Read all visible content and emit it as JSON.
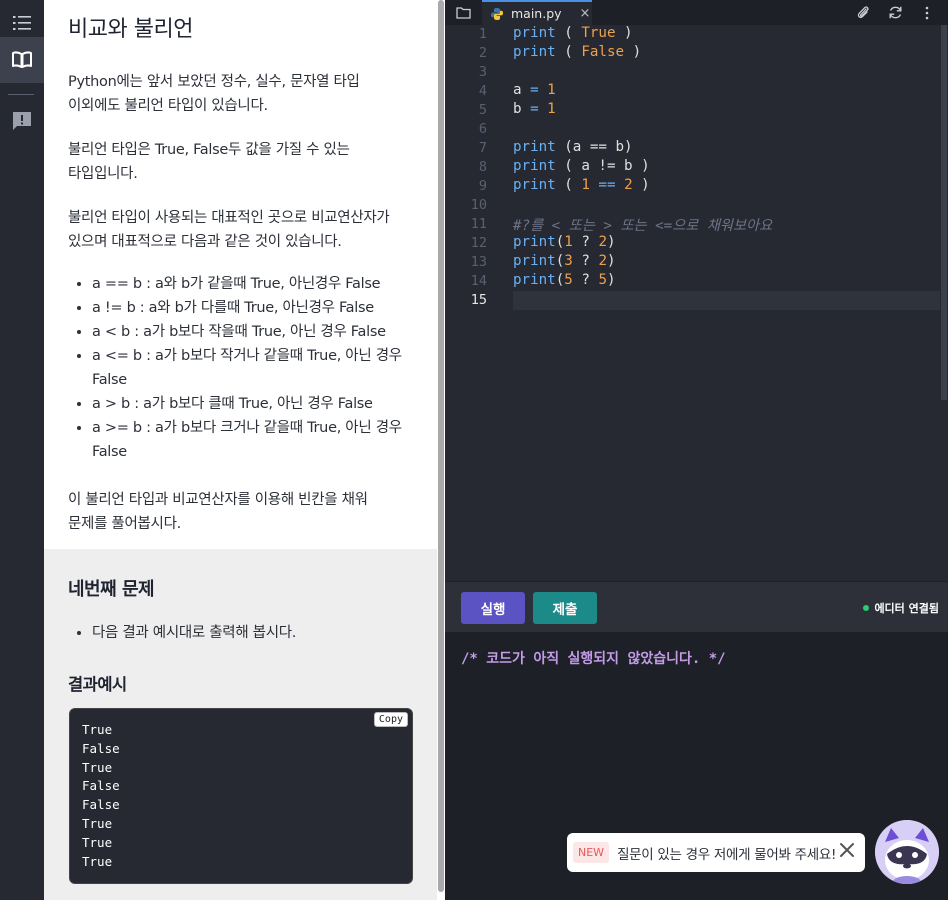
{
  "lesson": {
    "title": "비교와 불리언",
    "p1_line1": "Python에는 앞서 보았던 정수, 실수, 문자열 타입",
    "p1_line2": "이외에도 불리언 타입이 있습니다.",
    "p2_line1": "불리언 타입은 True, False두 값을 가질 수 있는",
    "p2_line2": "타입입니다.",
    "p3_line1": "불리언 타입이 사용되는 대표적인 곳으로 비교연산자가",
    "p3_line2": "있으며 대표적으로 다음과 같은 것이 있습니다.",
    "bullets": [
      {
        "l1": "a == b : a와 b가 같을때 True, 아닌경우 False",
        "l2": ""
      },
      {
        "l1": "a != b : a와 b가 다를때 True, 아닌경우 False",
        "l2": ""
      },
      {
        "l1": "a < b : a가 b보다 작을때 True, 아닌 경우 False",
        "l2": ""
      },
      {
        "l1": "a <= b : a가 b보다 작거나 같을때 True, 아닌 경우",
        "l2": "False"
      },
      {
        "l1": "a > b : a가 b보다 클때 True, 아닌 경우 False",
        "l2": ""
      },
      {
        "l1": "a >= b : a가 b보다 크거나 같을때 True, 아닌 경우",
        "l2": "False"
      }
    ],
    "p4_line1": "이 불리언 타입과 비교연산자를 이용해 빈칸을 채워",
    "p4_line2": "문제를 풀어봅시다."
  },
  "problem": {
    "title": "네번째 문제",
    "bullet": "다음 결과 예시대로 출력해 봅시다.",
    "example_title": "결과예시",
    "copy_label": "Copy",
    "output": [
      "True",
      "False",
      "True",
      "False",
      "False",
      "True",
      "True",
      "True"
    ]
  },
  "editor": {
    "tab_label": "main.py",
    "tab_close": "×",
    "line_numbers": [
      "1",
      "2",
      "3",
      "4",
      "5",
      "6",
      "7",
      "8",
      "9",
      "10",
      "11",
      "12",
      "13",
      "14",
      "15"
    ],
    "current_line": "15",
    "run_label": "실행",
    "submit_label": "제출",
    "status_label": "에디터 연결됨",
    "console_message": "/* 코드가 아직 실행되지 않았습니다. */"
  },
  "code": {
    "l1": {
      "fn": "print",
      "a": " ( ",
      "b": "True",
      "c": " )"
    },
    "l2": {
      "fn": "print",
      "a": " ( ",
      "b": "False",
      "c": " )"
    },
    "l4": {
      "v": "a",
      "op": " = ",
      "n": "1"
    },
    "l5": {
      "v": "b",
      "op": " = ",
      "n": "1"
    },
    "l7": {
      "fn": "print",
      "rest": " (a == b)"
    },
    "l8": {
      "fn": "print",
      "rest": " ( a != b )"
    },
    "l9": {
      "fn": "print",
      "a": " ( ",
      "n1": "1",
      "op": " == ",
      "n2": "2",
      "c": " )"
    },
    "l11": "#?를 < 또는 > 또는 <=으로 채워보아요",
    "l12": {
      "fn": "print",
      "o": "(",
      "n1": "1",
      "q": " ? ",
      "n2": "2",
      "c": ")"
    },
    "l13": {
      "fn": "print",
      "o": "(",
      "n1": "3",
      "q": " ? ",
      "n2": "2",
      "c": ")"
    },
    "l14": {
      "fn": "print",
      "o": "(",
      "n1": "5",
      "q": " ? ",
      "n2": "5",
      "c": ")"
    }
  },
  "chat": {
    "badge": "NEW",
    "text": "질문이 있는 경우 저에게 물어봐 주세요!"
  },
  "icons": {
    "toc": "list-icon",
    "lesson": "book-icon",
    "feedback": "feedback-icon",
    "folder": "folder-icon",
    "python": "python-icon",
    "attach": "paperclip-icon",
    "reset": "refresh-icon",
    "more": "more-vertical-icon",
    "close": "close-icon",
    "mascot": "mascot-icon"
  },
  "colors": {
    "run": "#5b52c4",
    "submit": "#1d8a8a",
    "connected": "#2ecc71",
    "console_text": "#c39be8"
  }
}
